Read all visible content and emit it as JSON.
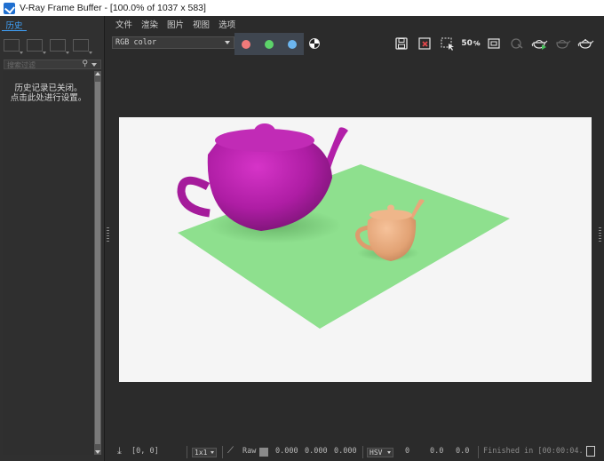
{
  "window": {
    "title": "V-Ray Frame Buffer - [100.0% of 1037 x 583]"
  },
  "history_panel": {
    "tab_label": "历史",
    "search_placeholder": "搜索过滤",
    "empty_message_line1": "历史记录已关闭。",
    "empty_message_line2": "点击此处进行设置。"
  },
  "menu": {
    "items": [
      "文件",
      "渲染",
      "图片",
      "视图",
      "选项"
    ]
  },
  "toolbar": {
    "channel": "RGB color",
    "color_buttons": [
      {
        "name": "red-channel-button",
        "color": "#f07a7a"
      },
      {
        "name": "green-channel-button",
        "color": "#5cd36a"
      },
      {
        "name": "blue-channel-button",
        "color": "#6cb6f0"
      }
    ],
    "zoom_label": "50",
    "icons": [
      "save-icon",
      "clear-image-icon",
      "region-render-icon",
      "zoom-icon",
      "fit-icon",
      "track-mouse-icon",
      "render-icon",
      "interactive-render-icon",
      "stop-render-icon"
    ]
  },
  "statusbar": {
    "coords": "[0, 0]",
    "zoom": "1x1",
    "raw_label": "Raw",
    "rgb_values": [
      "0.000",
      "0.000",
      "0.000"
    ],
    "color_space": "HSV",
    "hsv_values": [
      "0",
      "0.0",
      "0.0"
    ],
    "status_text": "Finished in [00:00:04."
  },
  "colors": {
    "accent": "#3fa4ff",
    "teapot_large": "#b21fa8",
    "teapot_small": "#e8a77a",
    "ground_plane": "#8ee08e"
  }
}
